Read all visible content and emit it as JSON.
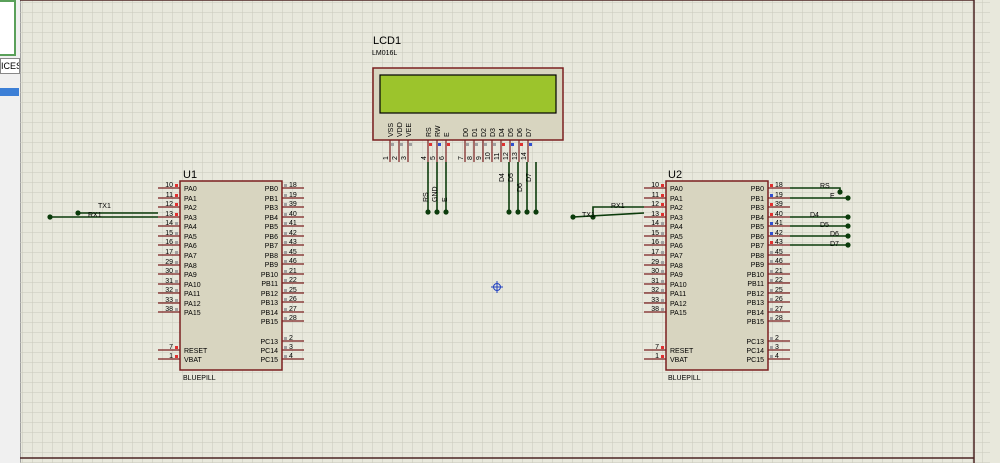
{
  "panel": {
    "tab_text": "ICES"
  },
  "lcd": {
    "ref": "LCD1",
    "part": "LM016L",
    "pin_labels": [
      "VSS",
      "VDD",
      "VEE",
      "RS",
      "RW",
      "E",
      "D0",
      "D1",
      "D2",
      "D3",
      "D4",
      "D5",
      "D6",
      "D7"
    ],
    "pin_numbers": [
      "1",
      "2",
      "3",
      "4",
      "5",
      "6",
      "7",
      "8",
      "9",
      "10",
      "11",
      "12",
      "13",
      "14"
    ],
    "net_labels": [
      "RS",
      "GND",
      "E",
      "D4",
      "D5",
      "D6",
      "D7"
    ]
  },
  "u1": {
    "ref": "U1",
    "part": "BLUEPILL",
    "left_pins": [
      {
        "num": "10",
        "name": "PA0"
      },
      {
        "num": "11",
        "name": "PA1"
      },
      {
        "num": "12",
        "name": "PA2"
      },
      {
        "num": "13",
        "name": "PA3"
      },
      {
        "num": "14",
        "name": "PA4"
      },
      {
        "num": "15",
        "name": "PA5"
      },
      {
        "num": "16",
        "name": "PA6"
      },
      {
        "num": "17",
        "name": "PA7"
      },
      {
        "num": "29",
        "name": "PA8"
      },
      {
        "num": "30",
        "name": "PA9"
      },
      {
        "num": "31",
        "name": "PA10"
      },
      {
        "num": "32",
        "name": "PA11"
      },
      {
        "num": "33",
        "name": "PA12"
      },
      {
        "num": "38",
        "name": "PA15"
      },
      {
        "num": "7",
        "name": "RESET"
      },
      {
        "num": "1",
        "name": "VBAT"
      }
    ],
    "right_pins": [
      {
        "num": "18",
        "name": "PB0"
      },
      {
        "num": "19",
        "name": "PB1"
      },
      {
        "num": "39",
        "name": "PB3"
      },
      {
        "num": "40",
        "name": "PB4"
      },
      {
        "num": "41",
        "name": "PB5"
      },
      {
        "num": "42",
        "name": "PB6"
      },
      {
        "num": "43",
        "name": "PB7"
      },
      {
        "num": "45",
        "name": "PB8"
      },
      {
        "num": "46",
        "name": "PB9"
      },
      {
        "num": "21",
        "name": "PB10"
      },
      {
        "num": "22",
        "name": "PB11"
      },
      {
        "num": "25",
        "name": "PB12"
      },
      {
        "num": "26",
        "name": "PB13"
      },
      {
        "num": "27",
        "name": "PB14"
      },
      {
        "num": "28",
        "name": "PB15"
      },
      {
        "num": "2",
        "name": "PC13"
      },
      {
        "num": "3",
        "name": "PC14"
      },
      {
        "num": "4",
        "name": "PC15"
      }
    ],
    "net_labels": [
      "TX1",
      "RX1"
    ]
  },
  "u2": {
    "ref": "U2",
    "part": "BLUEPILL",
    "left_pins": [
      {
        "num": "10",
        "name": "PA0"
      },
      {
        "num": "11",
        "name": "PA1"
      },
      {
        "num": "12",
        "name": "PA2"
      },
      {
        "num": "13",
        "name": "PA3"
      },
      {
        "num": "14",
        "name": "PA4"
      },
      {
        "num": "15",
        "name": "PA5"
      },
      {
        "num": "16",
        "name": "PA6"
      },
      {
        "num": "17",
        "name": "PA7"
      },
      {
        "num": "29",
        "name": "PA8"
      },
      {
        "num": "30",
        "name": "PA9"
      },
      {
        "num": "31",
        "name": "PA10"
      },
      {
        "num": "32",
        "name": "PA11"
      },
      {
        "num": "33",
        "name": "PA12"
      },
      {
        "num": "38",
        "name": "PA15"
      },
      {
        "num": "7",
        "name": "RESET"
      },
      {
        "num": "1",
        "name": "VBAT"
      }
    ],
    "right_pins": [
      {
        "num": "18",
        "name": "PB0"
      },
      {
        "num": "19",
        "name": "PB1"
      },
      {
        "num": "39",
        "name": "PB3"
      },
      {
        "num": "40",
        "name": "PB4"
      },
      {
        "num": "41",
        "name": "PB5"
      },
      {
        "num": "42",
        "name": "PB6"
      },
      {
        "num": "43",
        "name": "PB7"
      },
      {
        "num": "45",
        "name": "PB8"
      },
      {
        "num": "46",
        "name": "PB9"
      },
      {
        "num": "21",
        "name": "PB10"
      },
      {
        "num": "22",
        "name": "PB11"
      },
      {
        "num": "25",
        "name": "PB12"
      },
      {
        "num": "26",
        "name": "PB13"
      },
      {
        "num": "27",
        "name": "PB14"
      },
      {
        "num": "28",
        "name": "PB15"
      },
      {
        "num": "2",
        "name": "PC13"
      },
      {
        "num": "3",
        "name": "PC14"
      },
      {
        "num": "4",
        "name": "PC15"
      }
    ],
    "net_labels": [
      "RX1",
      "TX1",
      "RS",
      "E",
      "D4",
      "D5",
      "D6",
      "D7"
    ]
  },
  "colors": {
    "background": "#e8e8dc",
    "grid": "#c9c9bb",
    "component_outline": "#7a1f1f",
    "component_fill": "#d8d5c0",
    "wire": "#0b3b0b",
    "lcd_screen": "#9cc42c",
    "pin_red": "#e03030",
    "pin_blue": "#3050d0",
    "pin_gray": "#a0a0a0"
  }
}
